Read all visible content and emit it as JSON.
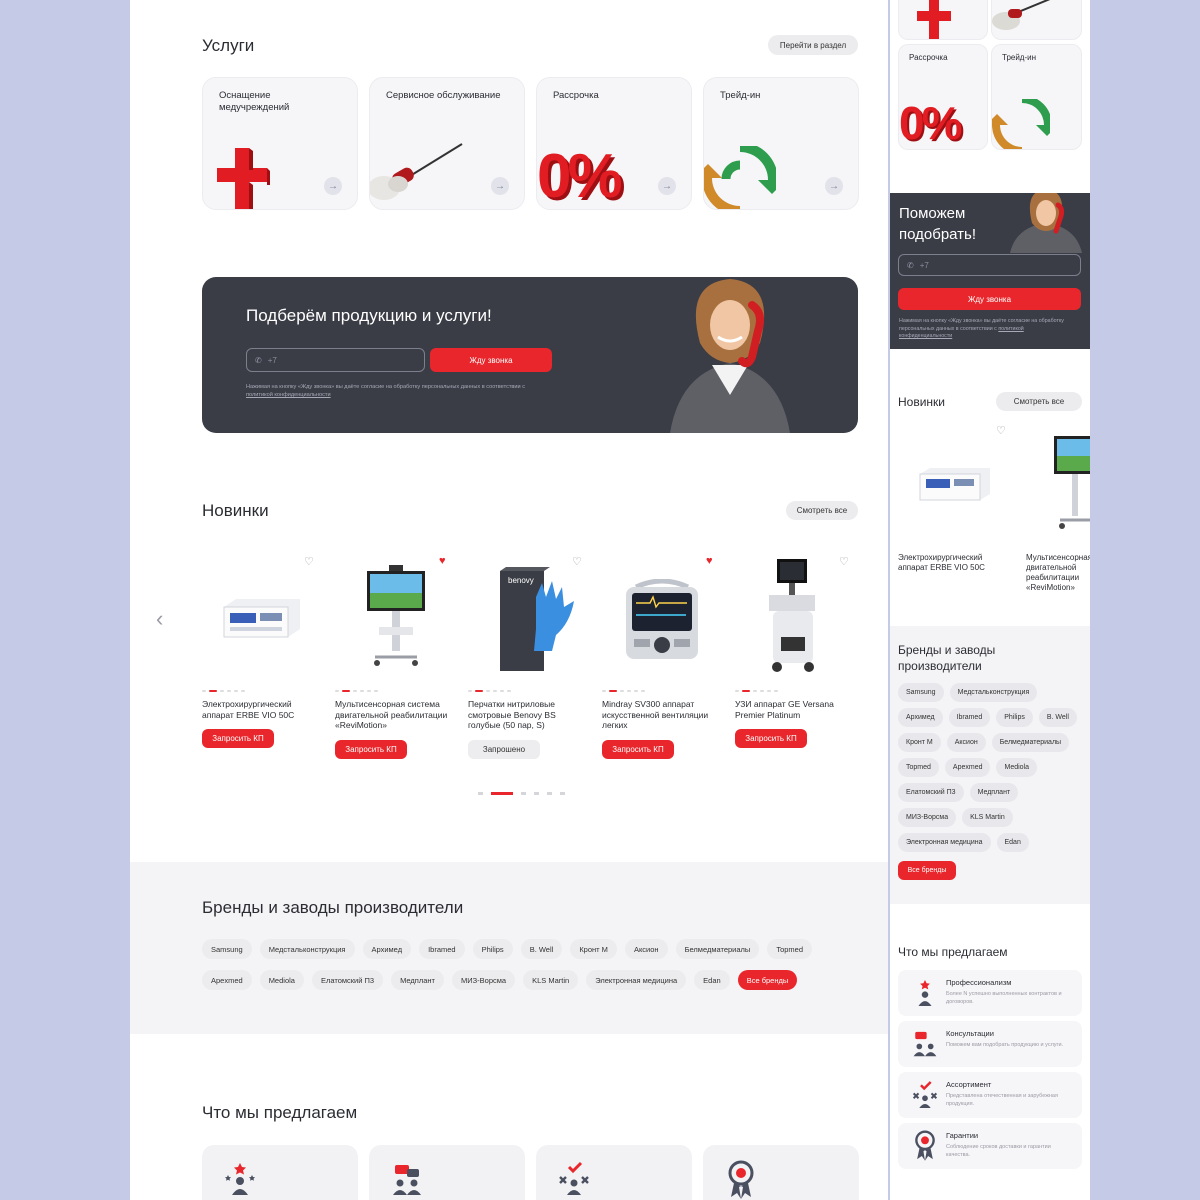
{
  "services": {
    "title": "Услуги",
    "goto_label": "Перейти в раздел",
    "cards": [
      {
        "label": "Оснащение медучреждений"
      },
      {
        "label": "Сервисное обслуживание"
      },
      {
        "label": "Рассрочка"
      },
      {
        "label": "Трейд-ин"
      }
    ],
    "zero_percent": "0%"
  },
  "callback": {
    "title": "Подберём продукцию и услуги!",
    "phone_placeholder": "+7",
    "button_label": "Жду звонка",
    "consent_text": "Нажимая на кнопку «Жду звонка» вы даёте согласие на обработку персональных данных в соответствии с",
    "consent_link": "политикой конфиденциальности"
  },
  "novelties": {
    "title": "Новинки",
    "view_all": "Смотреть все",
    "products": [
      {
        "name": "Электрохирургический аппарат ERBE VIO 50C",
        "button": "Запросить КП",
        "requested": false,
        "favorite": false
      },
      {
        "name": "Мультисенсорная система двигательной реабилитации «ReviMotion»",
        "button": "Запросить КП",
        "requested": false,
        "favorite": true
      },
      {
        "name": "Перчатки нитриловые смотровые Benovy BS голубые (50 пар, S)",
        "button": "Запрошено",
        "requested": true,
        "favorite": false
      },
      {
        "name": "Mindray SV300 аппарат искусственной вентиляции легких",
        "button": "Запросить КП",
        "requested": false,
        "favorite": true
      },
      {
        "name": "УЗИ аппарат GE Versana Premier Platinum",
        "button": "Запросить КП",
        "requested": false,
        "favorite": false
      }
    ],
    "glove_brand": "benovy"
  },
  "brands": {
    "title": "Бренды и заводы производители",
    "row1": [
      "Samsung",
      "Медстальконструкция",
      "Архимед",
      "Ibramed",
      "Philips",
      "B. Well",
      "Кронт М",
      "Аксион",
      "Белмедматериалы",
      "Topmed"
    ],
    "row2": [
      "Apexmed",
      "Mediola",
      "Елатомский П3",
      "Медплант",
      "МИЗ-Ворсма",
      "KLS Martin",
      "Электронная медицина",
      "Edan"
    ],
    "all_label": "Все бренды"
  },
  "offer": {
    "title": "Что мы предлагаем"
  },
  "mobile": {
    "services": [
      {
        "label": "Рассрочка"
      },
      {
        "label": "Трейд-ин"
      }
    ],
    "callback_title": "Поможем подобрать!",
    "phone_placeholder": "+7",
    "button_label": "Жду звонка",
    "consent_text": "Нажимая на кнопку «Жду звонка» вы даёте согласие на обработку персональных данных в соответствии с",
    "consent_link": "политикой конфиденциальности",
    "novelties_title": "Новинки",
    "view_all": "Смотреть все",
    "products": [
      {
        "name": "Электрохирургический аппарат ERBE VIO 50C"
      },
      {
        "name": "Мультисенсорная система двигательной реабилитации «ReviMotion»"
      }
    ],
    "brands_title": "Бренды и заводы производители",
    "brands": [
      "Samsung",
      "Медстальконструкция",
      "Архимед",
      "Ibramed",
      "Philips",
      "B. Well",
      "Кронт М",
      "Аксион",
      "Белмедматериалы",
      "Topmed",
      "Apexmed",
      "Mediola",
      "Елатомский П3",
      "Медплант",
      "МИЗ-Ворсма",
      "KLS Martin",
      "Электронная медицина",
      "Edan"
    ],
    "all_brands": "Все бренды",
    "offer_title": "Что мы предлагаем",
    "offers": [
      {
        "title": "Профессионализм",
        "desc": "Более N успешно выполненных контрактов и договоров."
      },
      {
        "title": "Консультации",
        "desc": "Поможем вам подобрать продукцию и услуги."
      },
      {
        "title": "Ассортимент",
        "desc": "Представлена отечественная и зарубежная продукция."
      },
      {
        "title": "Гарантии",
        "desc": "Соблюдение сроков доставки и гарантии качества."
      }
    ]
  },
  "colors": {
    "accent": "#e8262b",
    "banner": "#3a3c46",
    "page_bg": "#c5cbe6"
  }
}
